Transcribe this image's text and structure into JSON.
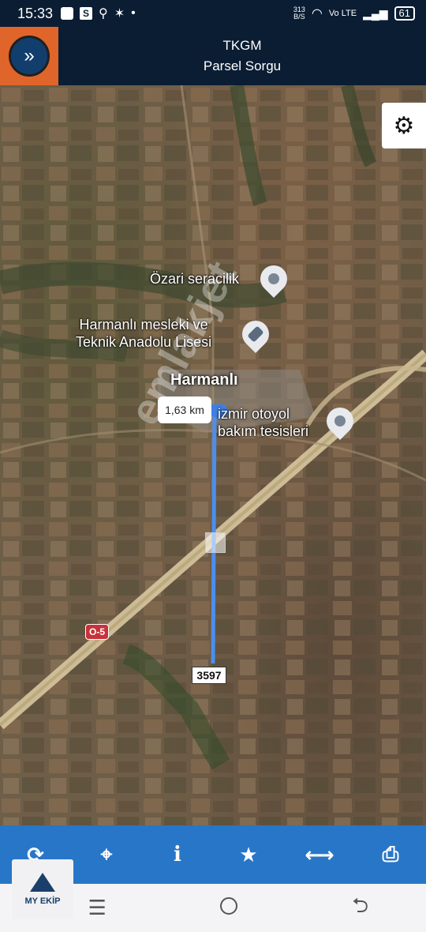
{
  "status_bar": {
    "time": "15:33",
    "icons": [
      "photo-icon",
      "s-app-icon",
      "location-icon",
      "star-icon",
      "dot-icon"
    ],
    "speed": "313\nB/S",
    "network": "Vo LTE",
    "battery": "61"
  },
  "header": {
    "title": "TKGM",
    "subtitle": "Parsel Sorgu",
    "menu_icon": "double-chevron-right-icon"
  },
  "map": {
    "places": [
      {
        "name": "Özari seracilik"
      },
      {
        "name": "Harmanlı mesleki ve\nTeknik Anadolu Lisesi"
      },
      {
        "name": "Harmanlı"
      },
      {
        "name": "izmir otoyol\nbakım tesisleri"
      }
    ],
    "distance_label": "1,63 km",
    "parcel_label": "3597",
    "road_badge": "O-5",
    "watermark": "emlakjet",
    "settings_icon": "gear-icon"
  },
  "toolbar": {
    "items": [
      {
        "name": "refresh-icon",
        "glyph": "⟳"
      },
      {
        "name": "crosshair-icon",
        "glyph": "⌖"
      },
      {
        "name": "info-icon",
        "glyph": "i"
      },
      {
        "name": "star-icon",
        "glyph": "★"
      },
      {
        "name": "measure-icon",
        "glyph": "⟷"
      },
      {
        "name": "print-icon",
        "glyph": "⎙"
      }
    ]
  },
  "navbar": {
    "recent_glyph": "☰",
    "back_glyph": "⮌"
  },
  "logo": {
    "text": "MY EKİP"
  },
  "colors": {
    "header_bg": "#0b1d33",
    "menu_accent": "#e0652a",
    "toolbar_bg": "#2876c8",
    "route_line": "#4a8ff0"
  }
}
